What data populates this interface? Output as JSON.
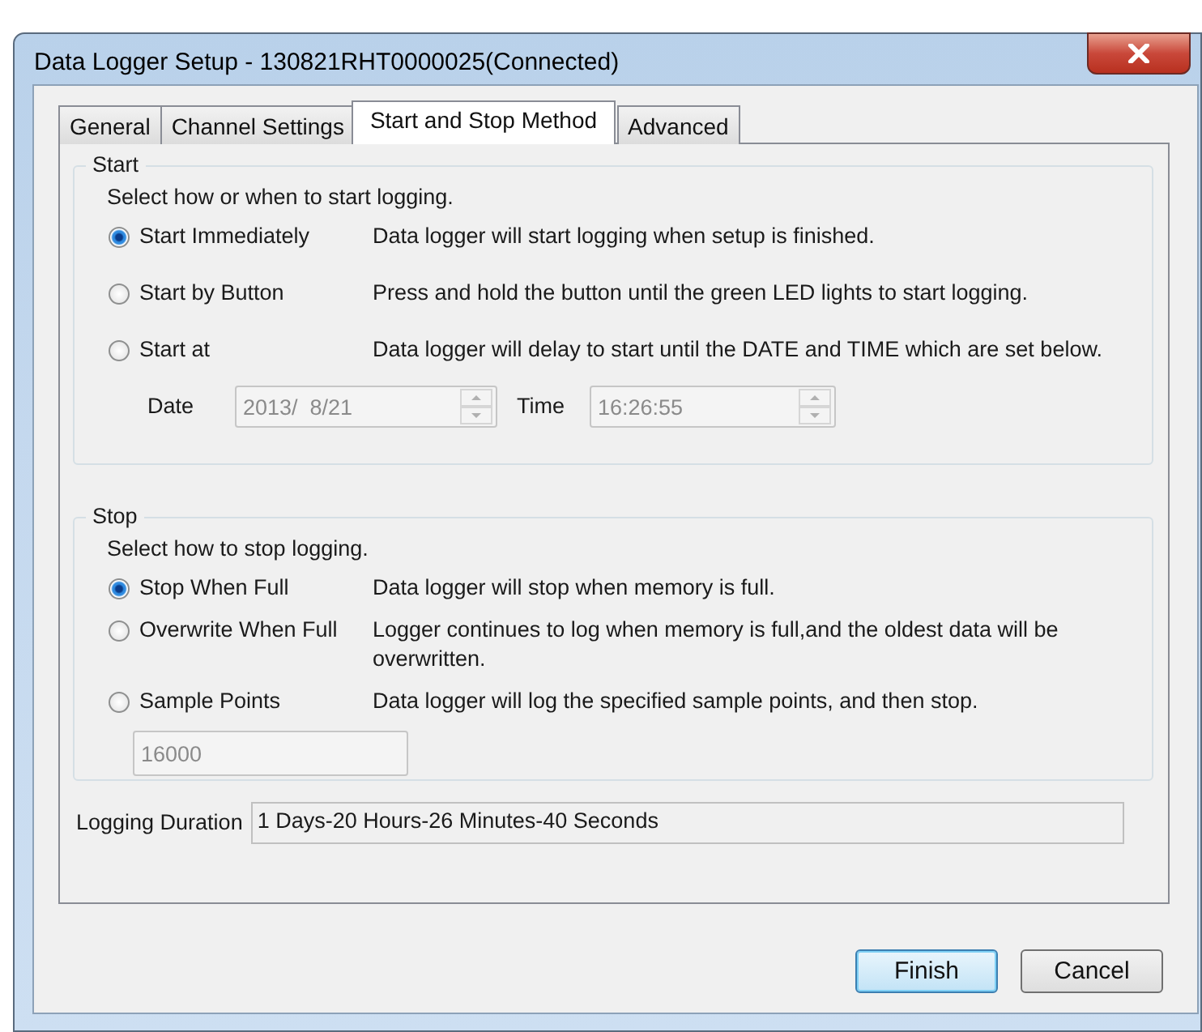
{
  "window": {
    "title": "Data Logger Setup - 130821RHT0000025(Connected)"
  },
  "tabs": [
    {
      "label": "General",
      "selected": false
    },
    {
      "label": "Channel Settings",
      "selected": false
    },
    {
      "label": "Start and Stop Method",
      "selected": true
    },
    {
      "label": "Advanced",
      "selected": false
    }
  ],
  "start": {
    "title": "Start",
    "prompt": "Select how or when to start logging.",
    "options": [
      {
        "label": "Start Immediately",
        "description": "Data logger will start logging when setup is finished.",
        "selected": true
      },
      {
        "label": "Start by Button",
        "description": "Press and hold the button until the green LED lights to start logging.",
        "selected": false
      },
      {
        "label": "Start at",
        "description": "Data logger will delay to start until the DATE and TIME which are set below.",
        "selected": false
      }
    ],
    "date": {
      "label": "Date",
      "value": "2013/  8/21",
      "disabled": true
    },
    "time": {
      "label": "Time",
      "value": "16:26:55",
      "disabled": true
    }
  },
  "stop": {
    "title": "Stop",
    "prompt": "Select how to stop logging.",
    "options": [
      {
        "label": "Stop When Full",
        "description": "Data logger will stop when memory is full.",
        "selected": true
      },
      {
        "label": "Overwrite When Full",
        "description": "Logger continues to log when memory is full,and the oldest data will be overwritten.",
        "selected": false
      },
      {
        "label": "Sample Points",
        "description": "Data logger will log the specified sample points, and then stop.",
        "selected": false
      }
    ],
    "sample_points": {
      "value": "16000",
      "disabled": true
    }
  },
  "logging_duration": {
    "label": "Logging Duration",
    "value": "1 Days-20 Hours-26 Minutes-40 Seconds"
  },
  "buttons": [
    {
      "label": "Finish",
      "default": true
    },
    {
      "label": "Cancel",
      "default": false
    }
  ]
}
